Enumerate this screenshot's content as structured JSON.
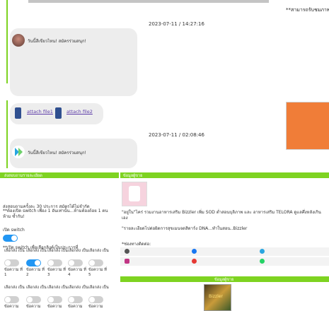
{
  "top": {
    "note": "**สามารถรับชมภาพเป็นไง"
  },
  "chat": {
    "timestamp1": "2023-07-11 / 14:27:16",
    "greeting1": "วันนี้สีเขียวไหน! สมัครร่วมสนุก!",
    "attach1": "attach file1",
    "attach2": "attach file2",
    "timestamp2": "2023-07-11 / 02:08:46",
    "greeting2": "วันนี้สีเขียวไหน! สมัครร่วมสนุก!"
  },
  "left_panel": {
    "header": "ส่งสอบถามรายละเอียด",
    "desc1": "ส่งสอบถามครั้งละ 30 ประการ สมัครได้ไม่จำกัด",
    "desc2": "**ต้องเปิด switch เพื่อง 1 อันเท่านั้น...ห้ามต้องถ้อย 1 ตน ห้าม ซ้ำกัน!",
    "switch_label": "เปิด switch",
    "switch_hint": "**เปิด switch เพื่อเลือกลิงค์เป็นประการที่",
    "choice_label": "เลือกส่ง เป็น",
    "items": [
      {
        "label": "ข้อความ ที่ 1",
        "on": false
      },
      {
        "label": "ข้อความ ที่ 2",
        "on": true
      },
      {
        "label": "ข้อความ ที่ 3",
        "on": false
      },
      {
        "label": "ข้อความ ที่ 4",
        "on": false
      },
      {
        "label": "ข้อความ ที่ 5",
        "on": false
      }
    ],
    "row2_item_label": "ข้อความ"
  },
  "right_panel": {
    "header": "ข้อมูลผู้ขาย",
    "desc1": "\"อยู่ใน\"ไคร่ รวมงานอาหารเสริม Bizzler เพิ่ม SOD ต่ำสอนบุลิภาพ และ อาหารเสริม TELORA ดูแลศึ่งหลังเกินเอง",
    "desc2": "\"รายละเอียดไปต่อผิดการสุขเมนจดสิตาร์ง DNA...ทำในสอน..Bizzler",
    "contact_label": "*ช่องทางติดต่อ:",
    "header2": "ข้อมูลผู้ขาย",
    "product_caption": "Bizzler"
  },
  "colors": {
    "accent_green": "#7ed321",
    "toggle_on": "#2196f3",
    "orange_box": "#f07d38"
  },
  "icons": {
    "contact": [
      "line-icon",
      "facebook-icon",
      "telegram-icon",
      "instagram-icon",
      "youtube-icon",
      "whatsapp-icon"
    ]
  }
}
